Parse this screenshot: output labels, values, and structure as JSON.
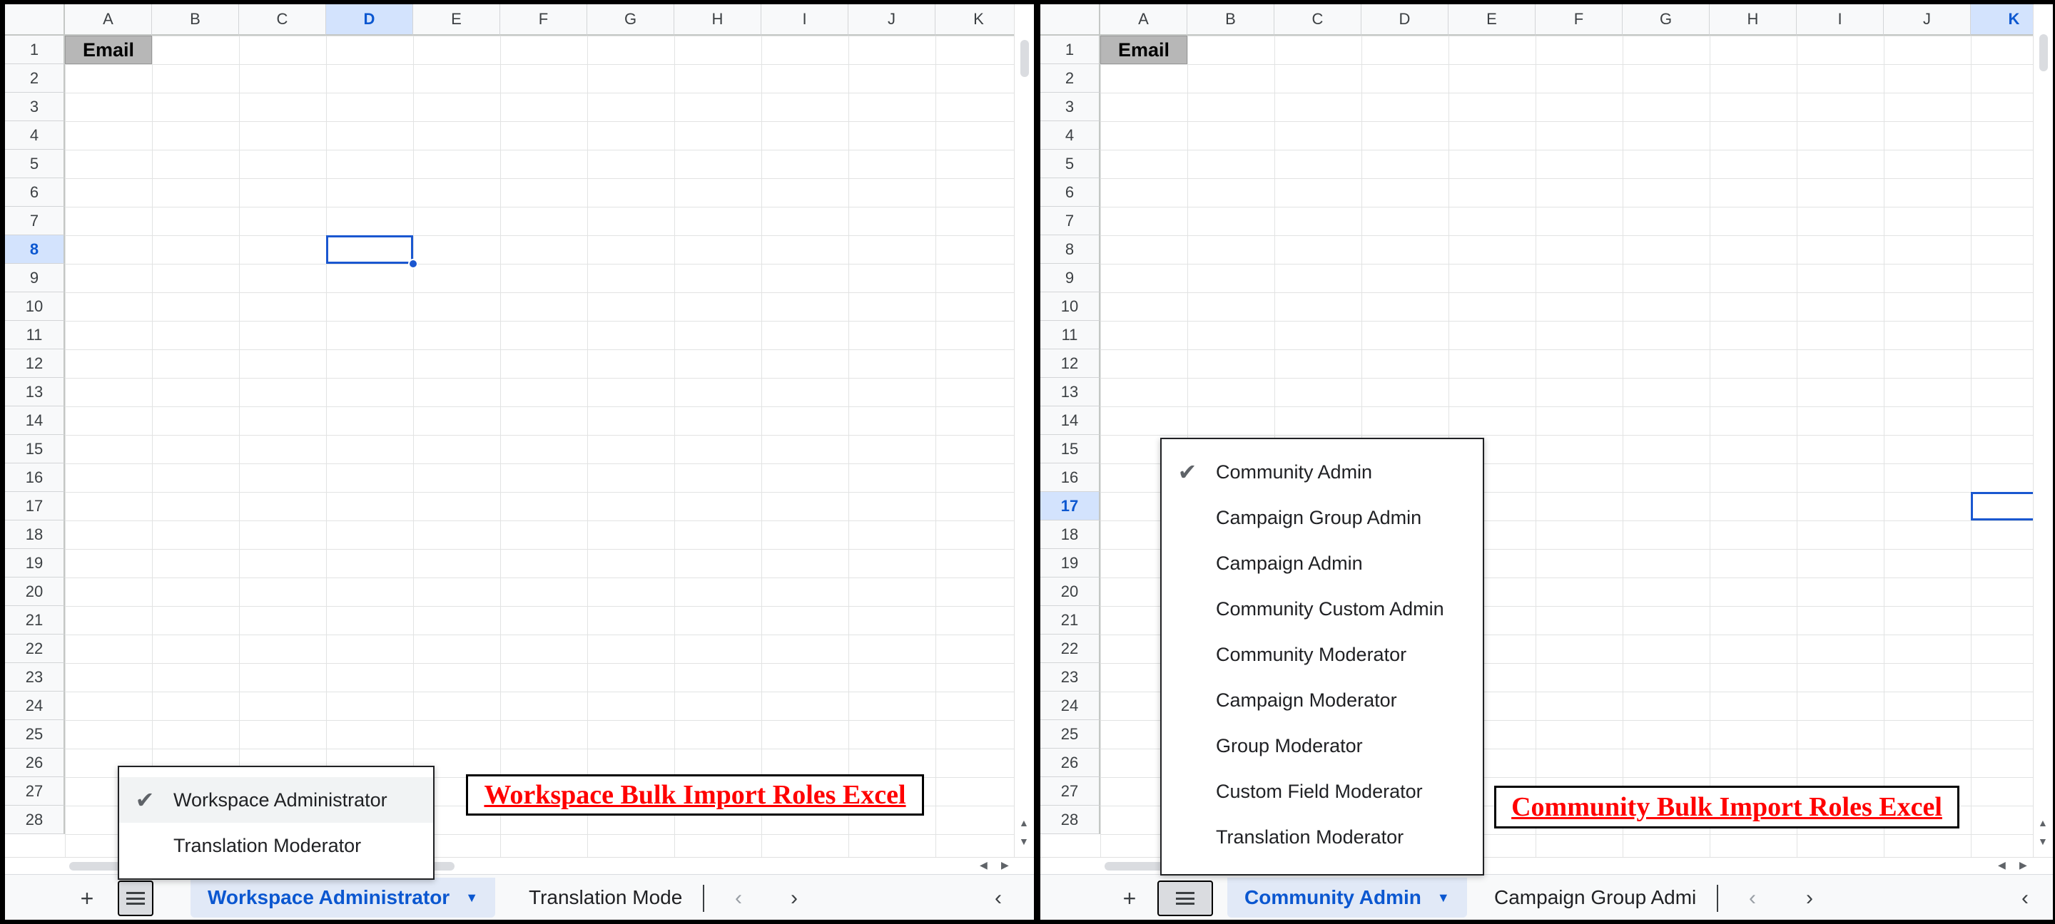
{
  "columns": [
    "A",
    "B",
    "C",
    "D",
    "E",
    "F",
    "G",
    "H",
    "I",
    "J",
    "K"
  ],
  "rows": [
    "1",
    "2",
    "3",
    "4",
    "5",
    "6",
    "7",
    "8",
    "9",
    "10",
    "11",
    "12",
    "13",
    "14",
    "15",
    "16",
    "17",
    "18",
    "19",
    "20",
    "21",
    "22",
    "23",
    "24",
    "25",
    "26",
    "27",
    "28"
  ],
  "left": {
    "selected_column": "D",
    "selected_row": "8",
    "cell_a1": "Email",
    "add_sheet_glyph": "+",
    "tabs": [
      {
        "label": "Workspace Administrator",
        "active": true
      },
      {
        "label": "Translation Mode"
      }
    ],
    "menu": {
      "items": [
        "Workspace Administrator",
        "Translation Moderator"
      ],
      "checked_index": 0
    },
    "caption": "Workspace Bulk Import Roles Excel"
  },
  "right": {
    "selected_column": "K",
    "selected_row": "17",
    "cell_a1": "Email",
    "add_sheet_glyph": "+",
    "tabs": [
      {
        "label": "Community Admin",
        "active": true
      },
      {
        "label": "Campaign Group Admi"
      }
    ],
    "menu": {
      "items": [
        "Community Admin",
        "Campaign Group Admin",
        "Campaign Admin",
        "Community Custom Admin",
        "Community Moderator",
        "Campaign Moderator",
        "Group Moderator",
        "Custom Field Moderator",
        "Translation Moderator"
      ],
      "checked_index": 0
    },
    "caption": "Community Bulk Import Roles Excel"
  },
  "icons": {
    "check": "check-icon",
    "caret": "caret-down-icon",
    "prev": "chevron-left-icon",
    "next": "chevron-right-icon",
    "collapse": "chevron-left-icon",
    "all_sheets": "hamburger-icon",
    "add": "plus-icon"
  },
  "colors": {
    "accent": "#0b57d0",
    "selection_border": "#1a57d0",
    "header_fill": "#b7b7b7",
    "caption_text": "#ff0000"
  }
}
